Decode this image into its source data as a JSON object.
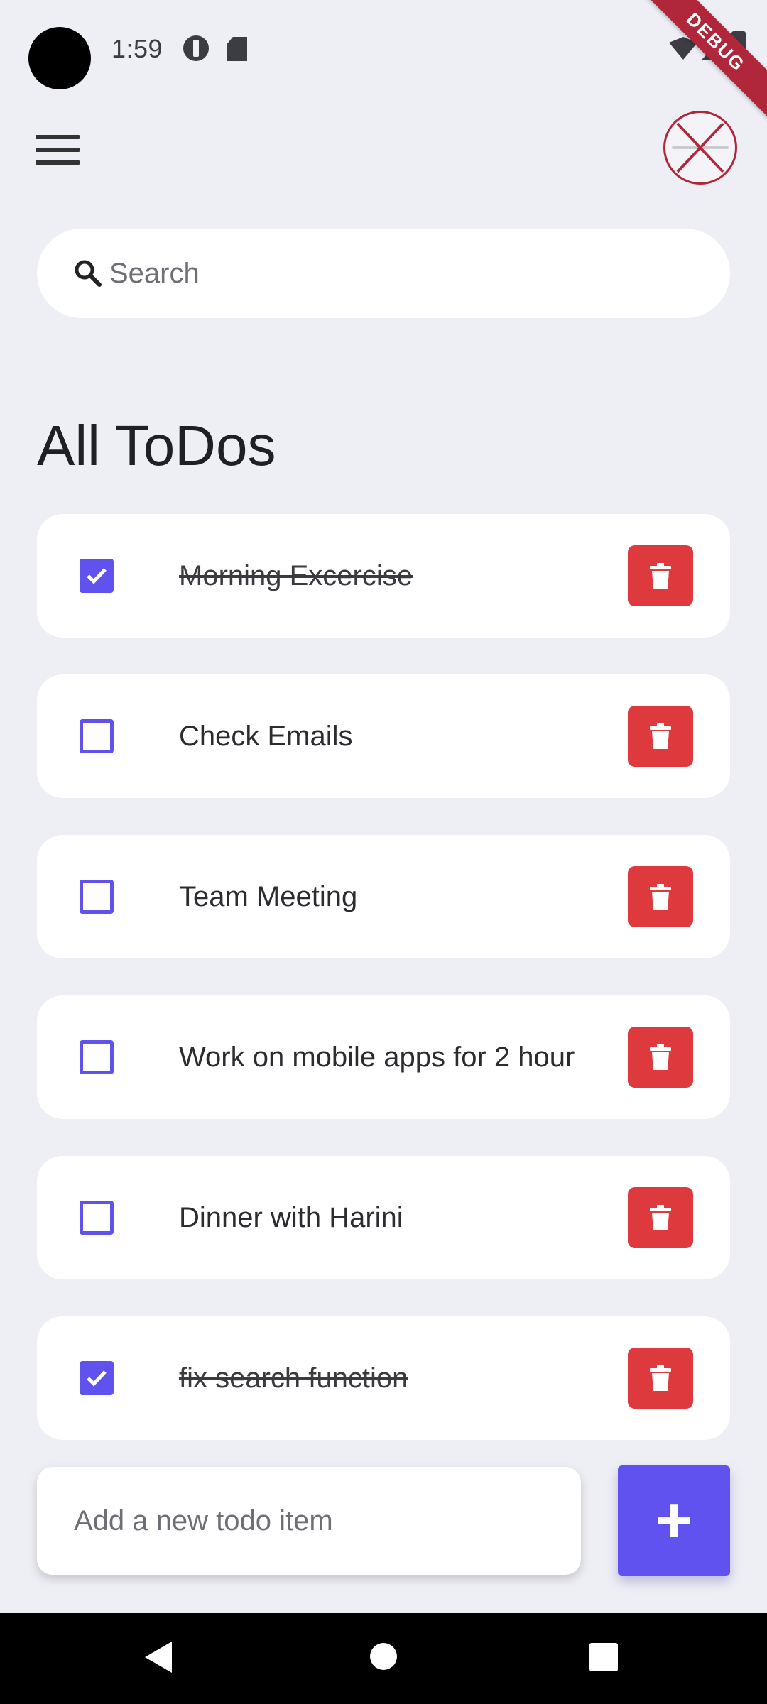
{
  "status_bar": {
    "time": "1:59"
  },
  "debug_banner": "DEBUG",
  "search": {
    "placeholder": "Search",
    "value": ""
  },
  "page": {
    "title": "All ToDos"
  },
  "todos": [
    {
      "text": "Morning Excercise",
      "done": true
    },
    {
      "text": "Check Emails",
      "done": false
    },
    {
      "text": "Team Meeting",
      "done": false
    },
    {
      "text": "Work on mobile apps for 2 hour",
      "done": false
    },
    {
      "text": "Dinner with Harini",
      "done": false
    },
    {
      "text": "fix search function",
      "done": true
    }
  ],
  "add_todo": {
    "placeholder": "Add a new todo item",
    "button_label": "+"
  },
  "colors": {
    "accent": "#5F52EE",
    "delete": "#DE3A3E",
    "background": "#EEEFF5"
  },
  "icons": {
    "menu": "hamburger-menu-icon",
    "search": "search-icon",
    "delete": "trash-icon",
    "check": "check-icon"
  }
}
